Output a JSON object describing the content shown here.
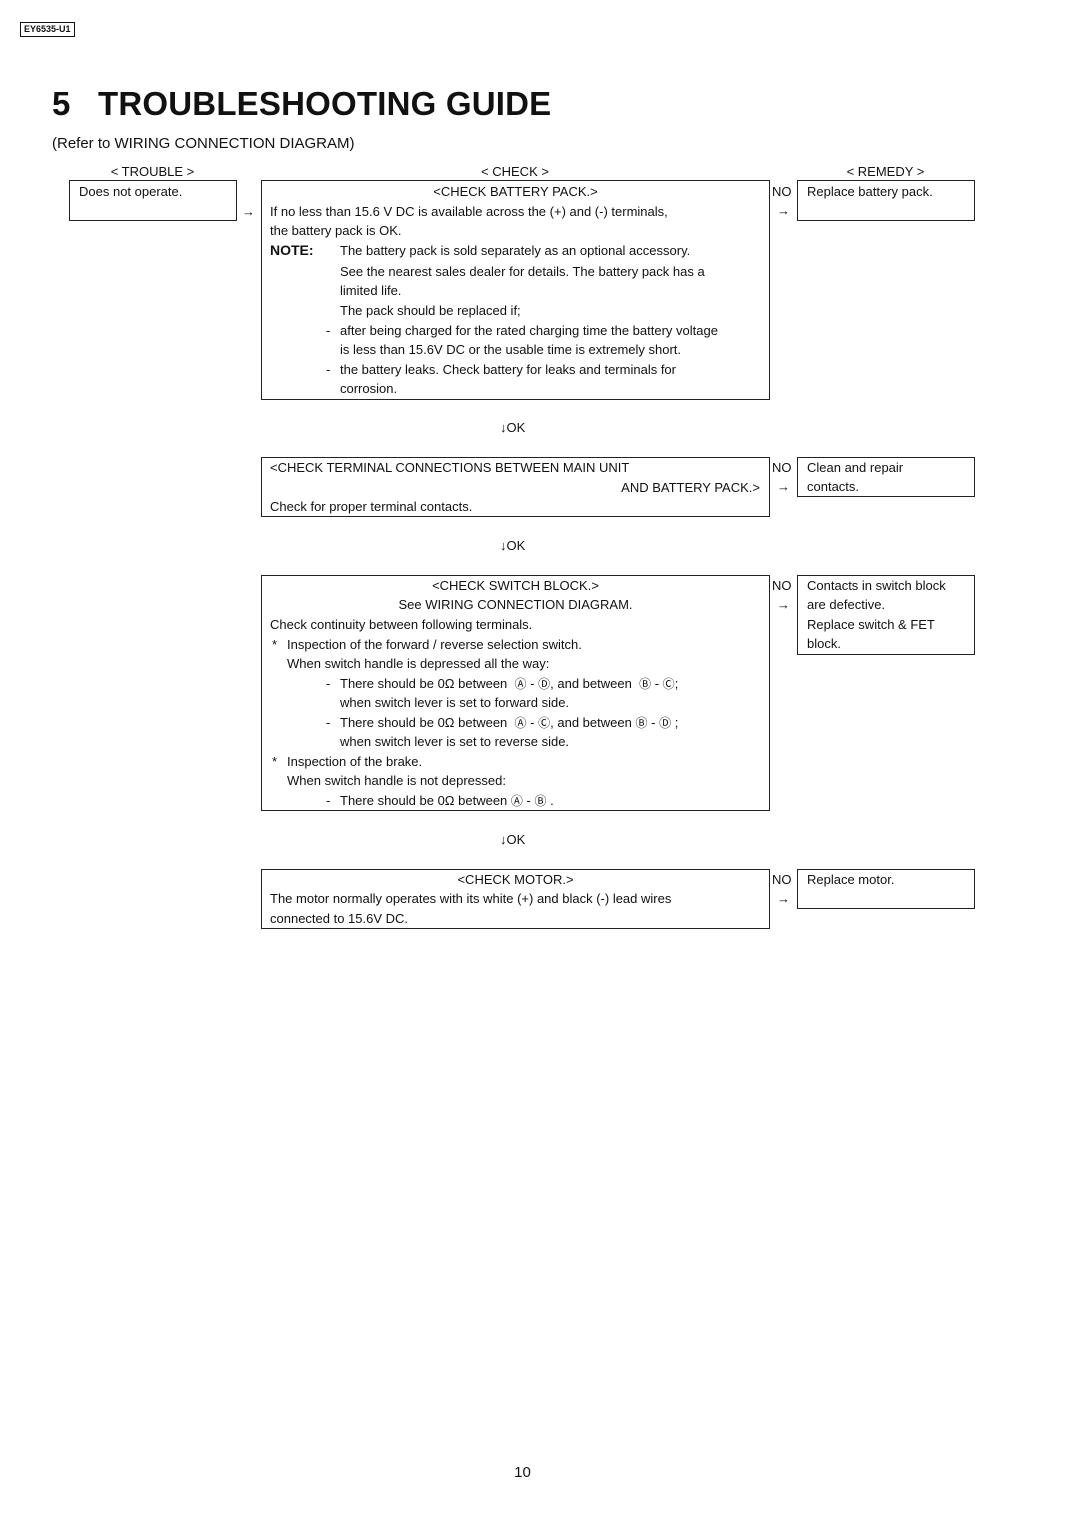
{
  "doc_id": "EY6535-U1",
  "title": {
    "number": "5",
    "text": "TROUBLESHOOTING GUIDE"
  },
  "subtitle": "(Refer to WIRING CONNECTION DIAGRAM)",
  "columns": {
    "trouble": "< TROUBLE >",
    "check": "< CHECK >",
    "remedy": "< REMEDY >"
  },
  "trouble": {
    "text": "Does not operate."
  },
  "symbols": {
    "right_arrow": "→",
    "down_arrow": "↓",
    "no": "NO",
    "ok": "OK"
  },
  "steps": [
    {
      "heading": "<CHECK BATTERY PACK.>",
      "lines": [
        "If no less than 15.6 V DC is available across the (+) and (-) terminals,",
        "the battery pack is OK."
      ],
      "note_label": "NOTE:",
      "note_lines": [
        "The battery pack is sold separately as an optional accessory.",
        "See the nearest sales dealer for details. The battery pack has a",
        "limited life.",
        "The pack should be replaced if;"
      ],
      "bullets": [
        {
          "dash": "-",
          "lines": [
            "after being charged for the rated charging time the battery voltage",
            "is less than 15.6V DC or the usable time is extremely short."
          ]
        },
        {
          "dash": "-",
          "lines": [
            "the battery leaks. Check battery for leaks and terminals for",
            "corrosion."
          ]
        }
      ],
      "remedy": [
        "Replace battery pack."
      ]
    },
    {
      "heading_line1": "<CHECK TERMINAL CONNECTIONS BETWEEN MAIN UNIT",
      "heading_line2": "AND BATTERY PACK.>",
      "lines": [
        "Check for proper terminal contacts."
      ],
      "remedy": [
        "Clean and repair",
        "contacts."
      ]
    },
    {
      "heading": "<CHECK SWITCH BLOCK.>",
      "subheading": "See WIRING CONNECTION DIAGRAM.",
      "intro": "Check continuity between following terminals.",
      "inspection1": {
        "star": "*",
        "title": "Inspection of the forward / reverse selection switch.",
        "condition": "When switch handle is depressed all the way:"
      },
      "forward": {
        "dash": "-",
        "prefix": "There should be 0Ω between",
        "a1": "Ⓐ",
        "sep1": "-",
        "a2": "Ⓓ",
        "mid": ", and between",
        "b1": "Ⓑ",
        "sep2": "-",
        "b2": "Ⓒ",
        "end": ";",
        "line2": "when switch lever is set to forward side."
      },
      "reverse": {
        "dash": "-",
        "prefix": "There should be 0Ω between",
        "a1": "Ⓐ",
        "sep1": "-",
        "a2": "Ⓒ",
        "mid": ", and between",
        "b1": "Ⓑ",
        "sep2": "-",
        "b2": "Ⓓ",
        "end": ";",
        "line2": "when switch lever is set to reverse side."
      },
      "inspection2": {
        "star": "*",
        "title": "Inspection of the brake.",
        "condition": "When switch handle is not depressed:"
      },
      "brake": {
        "dash": "-",
        "prefix": "There should be 0Ω between",
        "a1": "Ⓐ",
        "sep1": "-",
        "a2": "Ⓑ",
        "end": "."
      },
      "remedy": [
        "Contacts in switch block",
        "are defective.",
        "Replace switch & FET",
        "block."
      ]
    },
    {
      "heading": "<CHECK MOTOR.>",
      "lines": [
        "The motor normally operates with its white (+) and black (-) lead wires",
        "connected to 15.6V DC."
      ],
      "remedy": [
        "Replace motor."
      ]
    }
  ],
  "page_number": "10"
}
